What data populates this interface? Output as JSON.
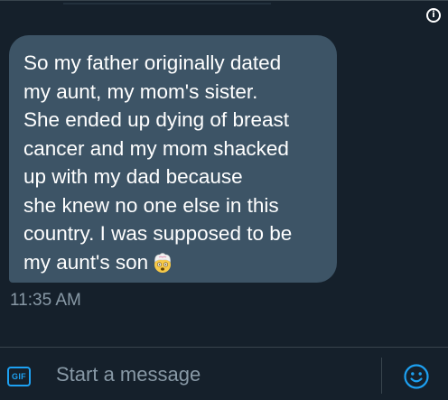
{
  "conversation": {
    "info_icon": "info-icon",
    "message": {
      "lines": [
        "So my father originally dated",
        "my aunt, my mom's sister.",
        "She ended up dying of breast",
        "cancer and my mom shacked",
        "up with my dad because",
        "she knew no one else in this",
        "country. I was supposed to be",
        "my aunt's son"
      ],
      "emoji": "exploding-head-emoji",
      "timestamp": "11:35 AM"
    }
  },
  "composer": {
    "gif_label": "GIF",
    "placeholder": "Start a message",
    "emoji_icon": "smiley-icon"
  },
  "colors": {
    "background": "#15202b",
    "bubble": "#3d5466",
    "accent": "#1da1f2",
    "muted_text": "#8899a6"
  }
}
